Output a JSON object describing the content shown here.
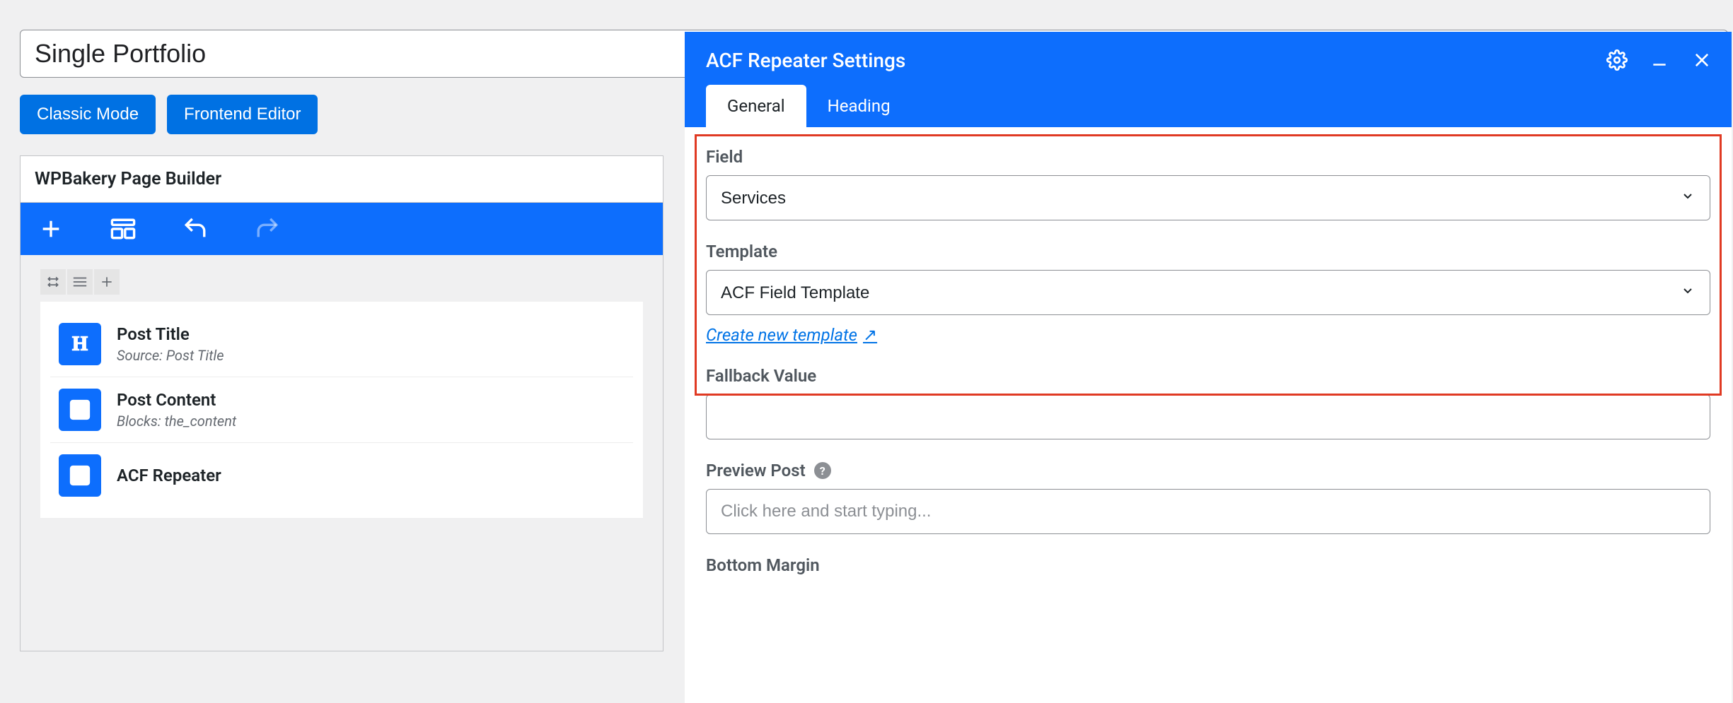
{
  "page": {
    "title_value": "Single Portfolio"
  },
  "mode_buttons": {
    "classic": "Classic Mode",
    "frontend": "Frontend Editor"
  },
  "wpb": {
    "header": "WPBakery Page Builder",
    "elements": [
      {
        "title": "Post Title",
        "sub": "Source: Post Title"
      },
      {
        "title": "Post Content",
        "sub": "Blocks: the_content"
      },
      {
        "title": "ACF Repeater",
        "sub": ""
      }
    ]
  },
  "panel": {
    "title": "ACF Repeater Settings",
    "tabs": {
      "general": "General",
      "heading": "Heading"
    },
    "field_label": "Field",
    "field_value": "Services",
    "template_label": "Template",
    "template_value": "ACF Field Template",
    "create_link": "Create new template",
    "fallback_label": "Fallback Value",
    "fallback_value": "",
    "preview_label": "Preview Post",
    "preview_placeholder": "Click here and start typing...",
    "bottom_margin_label": "Bottom Margin"
  }
}
